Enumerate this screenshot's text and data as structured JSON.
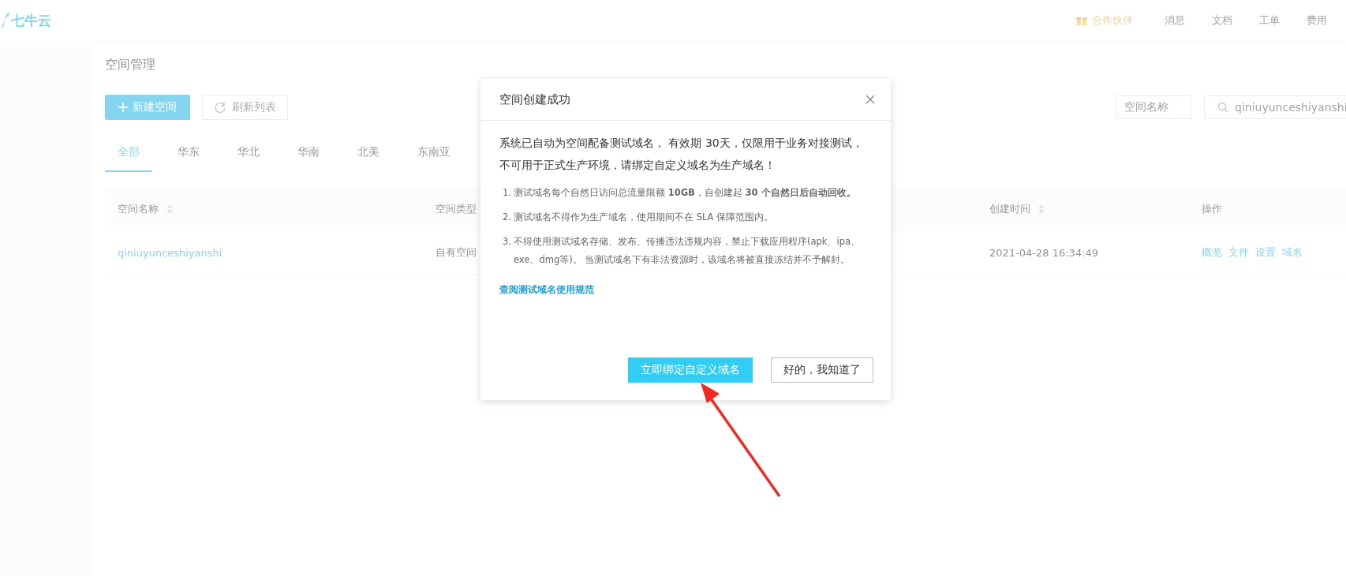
{
  "header": {
    "logo": "七牛云",
    "nav": [
      {
        "label": "合作伙伴",
        "kind": "partner"
      },
      {
        "label": "消息",
        "kind": "plain"
      },
      {
        "label": "文档",
        "kind": "plain"
      },
      {
        "label": "工单",
        "kind": "plain"
      },
      {
        "label": "费用",
        "kind": "plain"
      }
    ]
  },
  "page": {
    "title": "空间管理",
    "new_button": "新建空间",
    "refresh_button": "刷新列表",
    "filter_select": "空间名称",
    "search": {
      "value": "qiniuyunceshiyanshi"
    },
    "tabs": [
      {
        "label": "全部",
        "selected": true
      },
      {
        "label": "华东",
        "selected": false
      },
      {
        "label": "华北",
        "selected": false
      },
      {
        "label": "华南",
        "selected": false
      },
      {
        "label": "北美",
        "selected": false
      },
      {
        "label": "东南亚",
        "selected": false
      }
    ],
    "table": {
      "columns": [
        {
          "label": "空间名称",
          "sortable": true
        },
        {
          "label": "空间类型"
        },
        {
          "label": "创建时间",
          "sortable": true
        },
        {
          "label": "操作"
        }
      ],
      "rows": [
        {
          "name": "qiniuyunceshiyanshi",
          "type": "自有空间",
          "created": "2021-04-28 16:34:49",
          "actions": [
            "概览",
            "文件",
            "设置",
            "域名"
          ]
        }
      ]
    }
  },
  "dialog": {
    "title": "空间创建成功",
    "message": "系统已自动为空间配备测试域名， 有效期 30天，仅限用于业务对接测试，不可用于正式生产环境，请绑定自定义域名为生产域名！",
    "notes": [
      {
        "number": "1.",
        "text": "测试域名每个自然日访问总流量限额 **10GB**，自创建起 **30 个自然日后自动回收。**"
      },
      {
        "number": "2.",
        "text": "测试域名不得作为生产域名，使用期间不在 SLA 保障范围内。"
      },
      {
        "number": "3.",
        "text": "不得使用测试域名存储、发布、传播违法违规内容，禁止下载应用程序(apk、ipa、exe、dmg等)。 当测试域名下有非法资源时，该域名将被直接冻结并不予解封。"
      }
    ],
    "link": "查阅测试域名使用规范",
    "primary_button": "立即绑定自定义域名",
    "secondary_button": "好的，我知道了"
  }
}
